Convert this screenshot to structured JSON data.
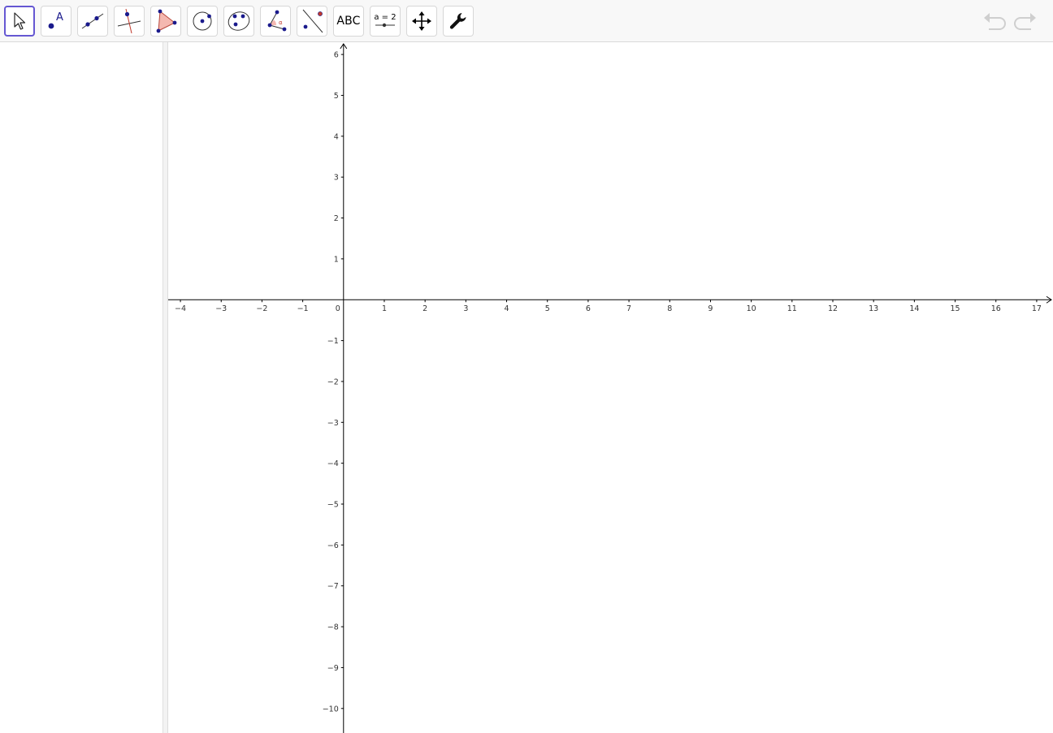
{
  "toolbar": {
    "tools": [
      {
        "name": "move-tool",
        "icon": "arrow-pointer-icon",
        "selected": true
      },
      {
        "name": "point-tool",
        "icon": "point-icon",
        "label": "A"
      },
      {
        "name": "line-tool",
        "icon": "line-through-points-icon"
      },
      {
        "name": "perpendicular-line-tool",
        "icon": "perpendicular-line-icon"
      },
      {
        "name": "polygon-tool",
        "icon": "polygon-icon"
      },
      {
        "name": "circle-tool",
        "icon": "circle-center-point-icon"
      },
      {
        "name": "conic-tool",
        "icon": "conic-through-points-icon"
      },
      {
        "name": "angle-tool",
        "icon": "angle-icon",
        "label": "α"
      },
      {
        "name": "reflect-tool",
        "icon": "reflect-about-line-icon"
      },
      {
        "name": "text-tool",
        "icon": "text-icon",
        "label": "ABC"
      },
      {
        "name": "slider-tool",
        "icon": "slider-icon",
        "label": "a = 2"
      },
      {
        "name": "move-graphics-view-tool",
        "icon": "move-arrows-icon"
      },
      {
        "name": "settings-tool",
        "icon": "wrench-icon"
      }
    ],
    "undo": {
      "icon": "undo-icon",
      "enabled": false
    },
    "redo": {
      "icon": "redo-icon",
      "enabled": false
    }
  },
  "algebra_view": {
    "items": []
  },
  "graphics_view": {
    "x_axis": {
      "min": -4.3,
      "max": 17.4,
      "ticks": [
        -4,
        -3,
        -2,
        -1,
        0,
        1,
        2,
        3,
        4,
        5,
        6,
        7,
        8,
        9,
        10,
        11,
        12,
        13,
        14,
        15,
        16,
        17
      ]
    },
    "y_axis": {
      "min": -10.6,
      "max": 6.3,
      "ticks": [
        -10,
        -9,
        -8,
        -7,
        -6,
        -5,
        -4,
        -3,
        -2,
        -1,
        1,
        2,
        3,
        4,
        5,
        6
      ]
    },
    "origin_label": "0",
    "grid": false
  },
  "colors": {
    "selected_border": "#6557d2",
    "point_blue": "#1a1a8c",
    "polygon_fill": "#f4b8b0",
    "accent_red": "#c0392b",
    "disabled_gray": "#cfcfcf"
  }
}
